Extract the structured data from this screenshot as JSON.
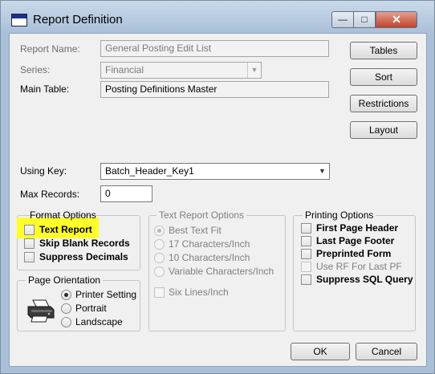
{
  "window": {
    "title": "Report Definition",
    "min_glyph": "—",
    "max_glyph": "□",
    "close_glyph": "✕"
  },
  "fields": {
    "report_name": {
      "label": "Report Name:",
      "value": "General Posting Edit List"
    },
    "series": {
      "label": "Series:",
      "value": "Financial"
    },
    "main_table": {
      "label": "Main Table:",
      "value": "Posting Definitions Master"
    },
    "using_key": {
      "label": "Using Key:",
      "value": "Batch_Header_Key1"
    },
    "max_records": {
      "label": "Max Records:",
      "value": "0"
    }
  },
  "side_buttons": {
    "tables": "Tables",
    "sort": "Sort",
    "restrictions": "Restrictions",
    "layout": "Layout"
  },
  "format_options": {
    "title": "Format Options",
    "text_report": {
      "label": "Text Report",
      "checked": false
    },
    "skip_blank_records": {
      "label": "Skip Blank Records",
      "checked": false
    },
    "suppress_decimals": {
      "label": "Suppress Decimals",
      "checked": false
    }
  },
  "text_report_options": {
    "title": "Text Report Options",
    "best_text_fit": {
      "label": "Best Text Fit",
      "selected": true
    },
    "chars_17": {
      "label": "17 Characters/Inch",
      "selected": false
    },
    "chars_10": {
      "label": "10 Characters/Inch",
      "selected": false
    },
    "variable_chars": {
      "label": "Variable Characters/Inch",
      "selected": false
    },
    "six_lines": {
      "label": "Six Lines/Inch",
      "checked": false
    }
  },
  "printing_options": {
    "title": "Printing Options",
    "first_page_header": {
      "label": "First Page Header",
      "checked": false
    },
    "last_page_footer": {
      "label": "Last Page Footer",
      "checked": false
    },
    "preprinted_form": {
      "label": "Preprinted Form",
      "checked": false
    },
    "use_rf_for_last_pf": {
      "label": "Use RF For Last PF",
      "checked": false
    },
    "suppress_sql_query": {
      "label": "Suppress SQL Query",
      "checked": false
    }
  },
  "page_orientation": {
    "title": "Page Orientation",
    "printer_setting": {
      "label": "Printer Setting",
      "selected": true
    },
    "portrait": {
      "label": "Portrait",
      "selected": false
    },
    "landscape": {
      "label": "Landscape",
      "selected": false
    }
  },
  "footer_buttons": {
    "ok": "OK",
    "cancel": "Cancel"
  },
  "colors": {
    "highlight": "#ffff2a",
    "title_bar": "#aac0d9",
    "close_button": "#c2432c"
  }
}
